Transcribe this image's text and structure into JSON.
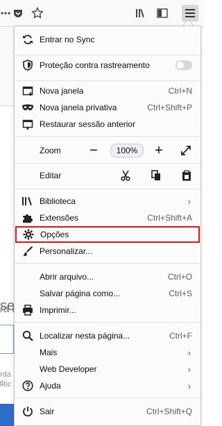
{
  "menu": {
    "sync": "Entrar no Sync",
    "tracking": "Proteção contra rastreamento",
    "new_window": {
      "label": "Nova janela",
      "shortcut": "Ctrl+N"
    },
    "private_window": {
      "label": "Nova janela privativa",
      "shortcut": "Ctrl+Shift+P"
    },
    "restore": "Restaurar sessão anterior",
    "zoom": {
      "label": "Zoom",
      "minus": "−",
      "value": "100%",
      "plus": "+"
    },
    "edit": "Editar",
    "library": "Biblioteca",
    "extensions": {
      "label": "Extensões",
      "shortcut": "Ctrl+Shift+A"
    },
    "options": "Opções",
    "customize": "Personalizar...",
    "open_file": {
      "label": "Abrir arquivo...",
      "shortcut": "Ctrl+O"
    },
    "save_page": {
      "label": "Salvar página como...",
      "shortcut": "Ctrl+S"
    },
    "print": "Imprimir...",
    "find": {
      "label": "Localizar nesta página...",
      "shortcut": "Ctrl+F"
    },
    "more": "Mais",
    "web_dev": "Web Developer",
    "help": "Ajuda",
    "quit": {
      "label": "Sair",
      "shortcut": "Ctrl+Shift+Q"
    },
    "submenu_arrow": "›"
  },
  "background": {
    "text1": "seu",
    "text2": "ra F",
    "small1": "rda c",
    "small2": "lític"
  },
  "colors": {
    "highlight": "#e0151b",
    "panel": "#fbfbfb"
  }
}
